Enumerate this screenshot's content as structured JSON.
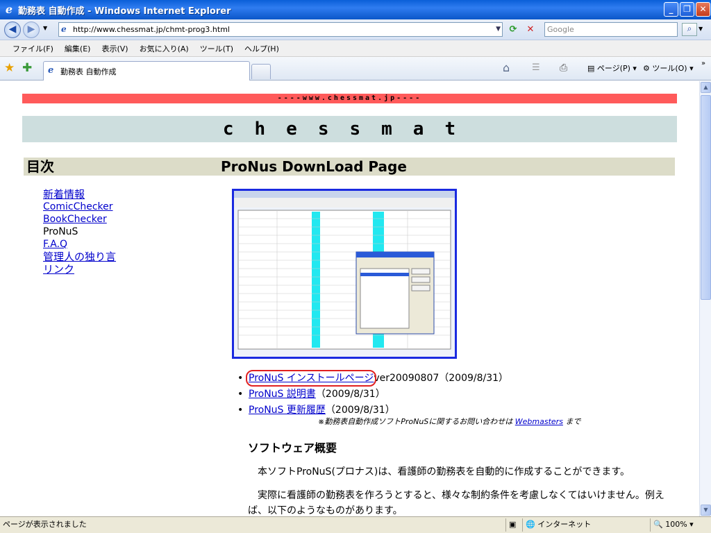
{
  "window": {
    "title": "勤務表 自動作成 - Windows Internet Explorer"
  },
  "address": {
    "url": "http://www.chessmat.jp/chmt-prog3.html",
    "search_placeholder": "Google"
  },
  "menu": [
    "ファイル(F)",
    "編集(E)",
    "表示(V)",
    "お気に入り(A)",
    "ツール(T)",
    "ヘルプ(H)"
  ],
  "tab": {
    "label": "勤務表 自動作成"
  },
  "commandbar": {
    "page": "ページ(P)",
    "tools": "ツール(O)"
  },
  "page": {
    "banner": "----www.chessmat.jp----",
    "logo": "chessmat",
    "toc_header": "目次",
    "main_header": "ProNus DownLoad Page",
    "toc": [
      {
        "label": "新着情報",
        "link": true
      },
      {
        "label": "ComicChecker",
        "link": true
      },
      {
        "label": "BookChecker",
        "link": true
      },
      {
        "label": "ProNuS",
        "link": false
      },
      {
        "label": "F.A.Q",
        "link": true
      },
      {
        "label": "管理人の独り言",
        "link": true
      },
      {
        "label": "リンク",
        "link": true
      }
    ],
    "downloads": [
      {
        "link": "ProNuS インストールページ",
        "suffix": "ver20090807（2009/8/31）"
      },
      {
        "link": "ProNuS 説明書",
        "suffix": "（2009/8/31）"
      },
      {
        "link": "ProNuS 更新履歴",
        "suffix": "（2009/8/31）"
      }
    ],
    "note_prefix": "※勤務表自動作成ソフトProNuSに関するお問い合わせは ",
    "note_link": "Webmasters",
    "note_suffix": " まで",
    "section_title": "ソフトウェア概要",
    "para1": "本ソフトProNuS(プロナス)は、看護師の勤務表を自動的に作成することができます。",
    "para2": "実際に看護師の勤務表を作ろうとすると、様々な制約条件を考慮しなくてはいけません。例えば、以下のようなものがあります。"
  },
  "status": {
    "text": "ページが表示されました",
    "zone": "インターネット",
    "zoom": "100%"
  }
}
